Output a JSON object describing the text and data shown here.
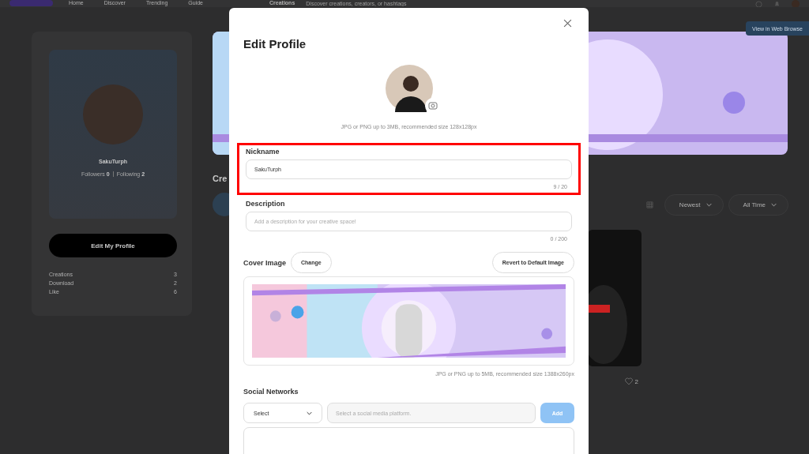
{
  "header": {
    "nav": [
      "Home",
      "Discover",
      "Trending",
      "Guide"
    ],
    "creations_menu": "Creations",
    "search": {
      "placeholder": "Discover creations, creators, or hashtags"
    }
  },
  "view_button": "View in Web Browse",
  "profile": {
    "name": "SakuTurph",
    "followers_label": "Followers",
    "followers": "0",
    "following_label": "Following",
    "following": "2",
    "edit_button": "Edit My Profile",
    "stats": [
      {
        "label": "Creations",
        "value": "3"
      },
      {
        "label": "Download",
        "value": "2"
      },
      {
        "label": "Like",
        "value": "6"
      }
    ]
  },
  "content": {
    "heading": "Cre",
    "sort": "Newest",
    "period": "All Time",
    "likes": "2"
  },
  "modal": {
    "title": "Edit Profile",
    "avatar_hint": "JPG or PNG up to 3MB, recommended size 128x128px",
    "fields": [
      {
        "label": "Nickname",
        "value": "SakuTurph",
        "counter": "9 / 20",
        "highlighted": true
      },
      {
        "label": "Description",
        "placeholder": "Add a description for your creative space!",
        "counter": "0 / 200",
        "highlighted": false
      }
    ],
    "cover": {
      "label": "Cover Image",
      "change": "Change",
      "revert": "Revert to Default Image",
      "hint": "JPG or PNG up to 5MB, recommended size 1388x260px"
    },
    "social": {
      "label": "Social Networks",
      "select": "Select",
      "input_placeholder": "Select a social media platform.",
      "add": {
        "label": "Add",
        "disabled": true
      }
    }
  }
}
